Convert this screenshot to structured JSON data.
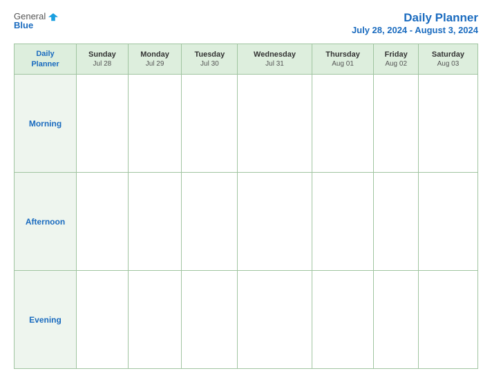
{
  "header": {
    "logo": {
      "general": "General",
      "blue": "Blue",
      "icon": "▶"
    },
    "title": "Daily Planner",
    "date_range": "July 28, 2024 - August 3, 2024"
  },
  "table": {
    "label_header": {
      "line1": "Daily",
      "line2": "Planner"
    },
    "days": [
      {
        "name": "Sunday",
        "date": "Jul 28"
      },
      {
        "name": "Monday",
        "date": "Jul 29"
      },
      {
        "name": "Tuesday",
        "date": "Jul 30"
      },
      {
        "name": "Wednesday",
        "date": "Jul 31"
      },
      {
        "name": "Thursday",
        "date": "Aug 01"
      },
      {
        "name": "Friday",
        "date": "Aug 02"
      },
      {
        "name": "Saturday",
        "date": "Aug 03"
      }
    ],
    "rows": [
      {
        "label": "Morning"
      },
      {
        "label": "Afternoon"
      },
      {
        "label": "Evening"
      }
    ]
  }
}
